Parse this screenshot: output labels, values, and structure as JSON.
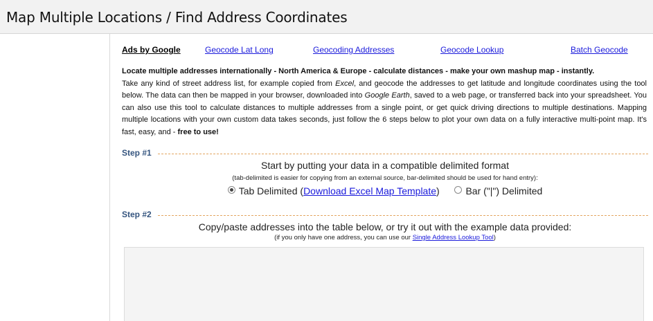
{
  "header": {
    "title": "Map Multiple Locations / Find Address Coordinates"
  },
  "ads": {
    "label": "Ads by Google",
    "links": [
      "Geocode Lat Long",
      "Geocoding Addresses",
      "Geocode Lookup",
      "Batch Geocode"
    ]
  },
  "intro": {
    "lead": "Locate multiple addresses internationally - North America & Europe - calculate distances - make your own mashup map - instantly.",
    "p1": "Take any kind of street address list, for example copied from ",
    "excel": "Excel",
    "p2": ", and geocode the addresses to get latitude and longitude coordinates using the tool below. The data can then be mapped in your browser, downloaded into ",
    "google_earth": "Google Earth",
    "p3": ", saved to a web page, or transferred back into your spreadsheet. You can also use this tool to calculate distances to multiple addresses from a single point, or get quick driving directions to multiple destinations. Mapping multiple locations with your own custom data takes seconds, just follow the 6 steps below to plot your own data on a fully interactive multi-point map. It's fast, easy, and - ",
    "free": "free to use!"
  },
  "step1": {
    "label": "Step #1",
    "instruction": "Start by putting your data in a compatible delimited format",
    "note": "(tab-delimited is easier for copying from an external source, bar-delimited should be used for hand entry):",
    "option_tab_prefix": "Tab Delimited (",
    "option_tab_link": "Download Excel Map Template",
    "option_tab_suffix": ")",
    "option_bar": "Bar (\"|\") Delimited",
    "selected": "tab"
  },
  "step2": {
    "label": "Step #2",
    "instruction": "Copy/paste addresses into the table below, or try it out with the example data provided:",
    "note_prefix": "(if you only have one address, you can use our ",
    "note_link": "Single Address Lookup Tool",
    "note_suffix": ")"
  }
}
